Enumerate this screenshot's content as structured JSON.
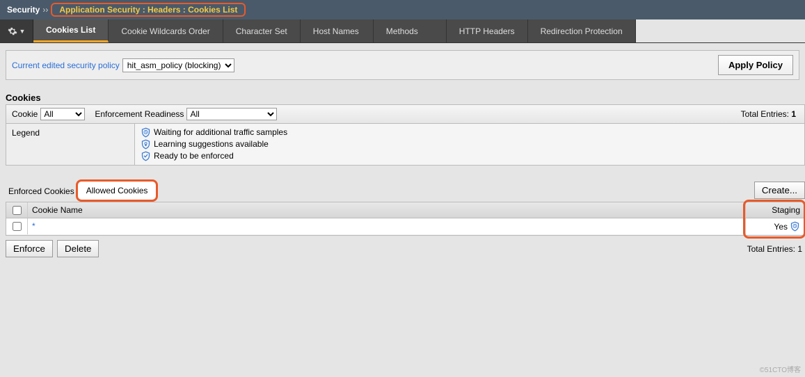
{
  "breadcrumb": {
    "root": "Security",
    "path": "Application Security : Headers : Cookies List"
  },
  "tabs": [
    {
      "label": "Cookies List",
      "active": true
    },
    {
      "label": "Cookie Wildcards Order",
      "active": false
    },
    {
      "label": "Character Set",
      "active": false
    },
    {
      "label": "Host Names",
      "active": false
    },
    {
      "label": "Methods",
      "active": false
    },
    {
      "label": "HTTP Headers",
      "active": false
    },
    {
      "label": "Redirection Protection",
      "active": false
    }
  ],
  "policy": {
    "label": "Current edited security policy",
    "selected": "hit_asm_policy (blocking)",
    "apply_button": "Apply Policy"
  },
  "section": {
    "title": "Cookies"
  },
  "filters": {
    "cookie_label": "Cookie",
    "cookie_value": "All",
    "readiness_label": "Enforcement Readiness",
    "readiness_value": "All",
    "total_label": "Total Entries:",
    "total_value": "1"
  },
  "legend": {
    "label": "Legend",
    "items": [
      "Waiting for additional traffic samples",
      "Learning suggestions available",
      "Ready to be enforced"
    ]
  },
  "subtabs": {
    "prelabel": "Enforced Cookies",
    "allowed_label": "Allowed Cookies",
    "create_button": "Create..."
  },
  "table": {
    "columns": {
      "name": "Cookie Name",
      "staging": "Staging"
    },
    "rows": [
      {
        "name": "*",
        "staging": "Yes"
      }
    ]
  },
  "actions": {
    "enforce": "Enforce",
    "delete": "Delete",
    "footer_total_label": "Total Entries:",
    "footer_total_value": "1"
  },
  "icons": {
    "gear": "gear-icon",
    "shield_wait": "shield-clock-icon",
    "shield_learn": "shield-lightbulb-icon",
    "shield_ready": "shield-check-icon"
  },
  "watermark": "©51CTO博客"
}
